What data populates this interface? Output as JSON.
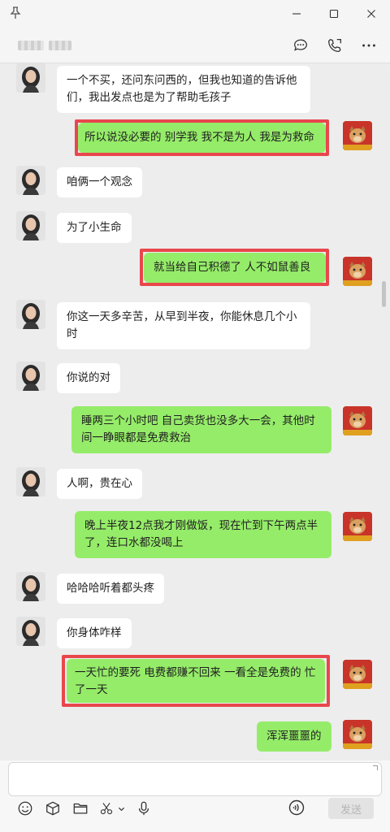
{
  "window": {
    "pin_icon": "pin-icon",
    "minimize_icon": "minimize-icon",
    "maximize_icon": "maximize-icon",
    "close_icon": "close-icon"
  },
  "header": {
    "contact_name_blurred": true,
    "icons": [
      "chat-bubble-icon",
      "phone-video-icon",
      "more-icon"
    ]
  },
  "colors": {
    "incoming_bubble": "#ffffff",
    "outgoing_bubble": "#95ec69",
    "highlight_border": "#e8474c",
    "chat_background": "#ededed"
  },
  "messages": [
    {
      "sender": "other",
      "text": "一个不买，还问东问西的，但我也知道的告诉他们，我出发点也是为了帮助毛孩子"
    },
    {
      "sender": "me",
      "text": "所以说没必要的 别学我  我不是为人 我是为救命",
      "highlighted": true
    },
    {
      "sender": "other",
      "text": "咱俩一个观念"
    },
    {
      "sender": "other",
      "text": "为了小生命"
    },
    {
      "sender": "me",
      "text": "就当给自己积德了  人不如鼠善良",
      "highlighted": true
    },
    {
      "sender": "other",
      "text": "你这一天多辛苦，从早到半夜，你能休息几个小时"
    },
    {
      "sender": "other",
      "text": "你说的对"
    },
    {
      "sender": "me",
      "text": "睡两三个小时吧  自己卖货也没多大一会，其他时间一睁眼都是免费救治"
    },
    {
      "sender": "other",
      "text": "人啊，贵在心"
    },
    {
      "sender": "me",
      "text": "晚上半夜12点我才刚做饭，现在忙到下午两点半了，连口水都没喝上"
    },
    {
      "sender": "other",
      "text": "哈哈哈听着都头疼"
    },
    {
      "sender": "other",
      "text": "你身体咋样"
    },
    {
      "sender": "me",
      "text": "一天忙的要死   电费都赚不回来 一看全是免费的 忙了一天",
      "highlighted": true
    },
    {
      "sender": "me",
      "text": "浑浑噩噩的"
    }
  ],
  "composer": {
    "input_value": "",
    "tools": [
      "emoji-icon",
      "box-icon",
      "folder-icon",
      "scissors-icon",
      "chevron-down-icon",
      "microphone-icon"
    ],
    "voice_icon": "voice-input-icon",
    "send_label": "发送"
  }
}
